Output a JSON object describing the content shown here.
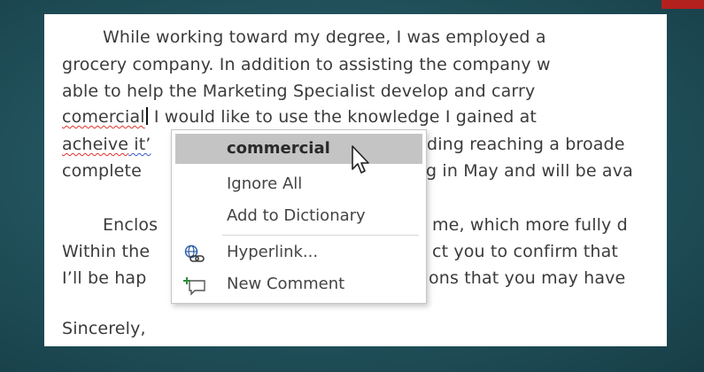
{
  "document": {
    "lines": [
      "While working toward my degree, I was employed a",
      "grocery company. In addition to assisting the company w",
      "able to help the Marketing Specialist develop and carry",
      "I would like to use the knowledge I gained at",
      "acheive it’",
      "complete",
      "Enclos",
      "Within the",
      "I’ll be hap",
      "Sincerely,"
    ],
    "line4_word": "comercial",
    "line4_rest": " I would like to use the knowledge I gained at",
    "line5_tail": "ding reaching a broade",
    "line6_tail": "g in May and will be ava",
    "line7_tail": "me, which more fully d",
    "line8_tail": "ct you to confirm that",
    "line9_tail": "ons that you may have"
  },
  "context_menu": {
    "suggestion": "commercial",
    "items": [
      {
        "label": "Ignore All",
        "icon": "none"
      },
      {
        "label": "Add to Dictionary",
        "icon": "none"
      },
      {
        "label": "Hyperlink...",
        "icon": "hyperlink-icon"
      },
      {
        "label": "New Comment",
        "icon": "new-comment-icon"
      }
    ]
  },
  "colors": {
    "spelling_underline": "#e0322a",
    "grammar_underline": "#3a58c8",
    "menu_highlight": "#c4c4c4",
    "accent": "#b3211e"
  }
}
